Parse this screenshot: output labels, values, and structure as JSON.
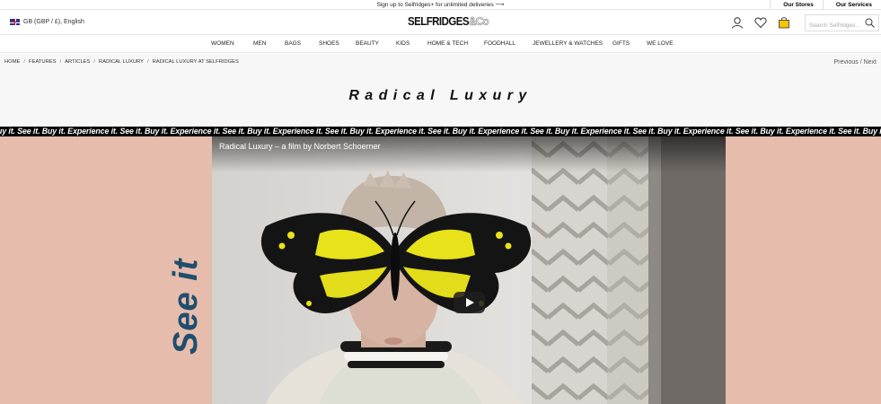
{
  "promo": {
    "text": "Sign up to Selfridges+ for unlimited deliveries",
    "arrow": "⟶"
  },
  "top_links": [
    "Our Stores",
    "Our Services"
  ],
  "header": {
    "locale": "GB (GBP / £), English",
    "logo_main": "SELFRIDGES",
    "logo_suffix": "&Co",
    "search_placeholder": "Search Selfridges..."
  },
  "nav": [
    "WOMEN",
    "MEN",
    "BAGS",
    "SHOES",
    "BEAUTY",
    "KIDS",
    "HOME & TECH",
    "FOODHALL",
    "JEWELLERY & WATCHES",
    "GIFTS",
    "WE LOVE"
  ],
  "breadcrumb": [
    "HOME",
    "FEATURES",
    "ARTICLES",
    "RADICAL LUXURY",
    "RADICAL LUXURY AT SELFRIDGES"
  ],
  "pager": {
    "previous": "Previous",
    "separator": "/",
    "next": "Next"
  },
  "page_title": "Radical Luxury",
  "ticker": ". Buy it. See it. Buy it. Experience it. See it. Buy it. Experience it. See it. Buy it. Experience it. See it. Buy it. Experience it. See it. Buy it. Experience it. See it. Buy it. Experience it. See it. Buy it. Experience it. See it. Buy it. Experience it. See it. Buy it. Experience it.",
  "hero": {
    "side_text": "See it",
    "video_title": "Radical Luxury – a film by Norbert Schoerner"
  },
  "colors": {
    "hero_bg": "#e6bcac",
    "side_text": "#1f4e6e",
    "ticker_bg": "#000000",
    "bag_icon": "#f2c500"
  },
  "icons": [
    "flag-icon",
    "account-icon",
    "wishlist-heart-icon",
    "shopping-bag-icon",
    "search-icon",
    "play-icon"
  ]
}
